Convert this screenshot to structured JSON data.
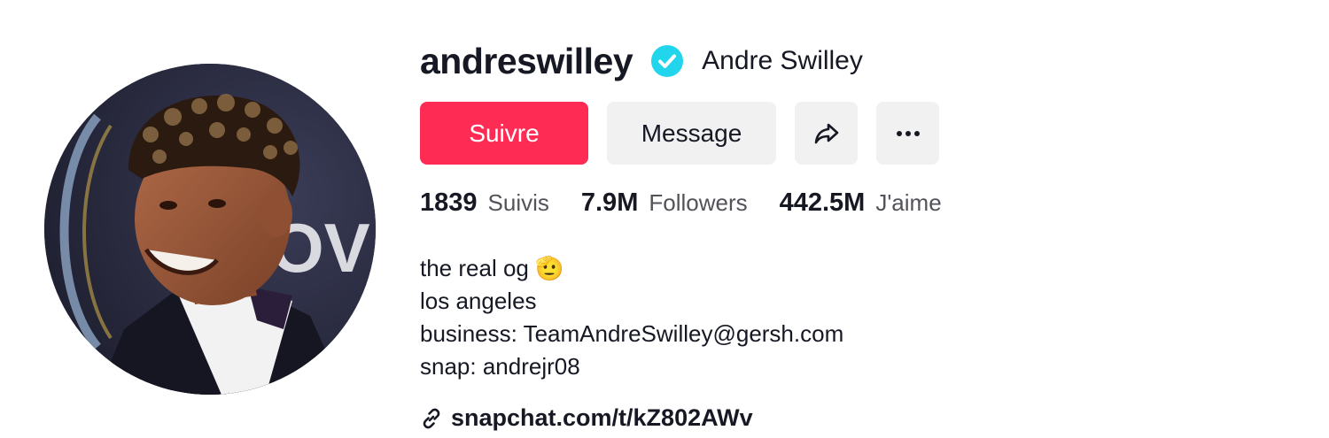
{
  "profile": {
    "username": "andreswilley",
    "display_name": "Andre Swilley",
    "verified": true
  },
  "actions": {
    "follow_label": "Suivre",
    "message_label": "Message"
  },
  "stats": [
    {
      "value": "1839",
      "label": "Suivis"
    },
    {
      "value": "7.9M",
      "label": "Followers"
    },
    {
      "value": "442.5M",
      "label": "J'aime"
    }
  ],
  "bio": {
    "line1": "the real og 🫡",
    "line2": "los angeles",
    "line3": "business: TeamAndreSwilley@gersh.com",
    "line4": "snap: andrejr08"
  },
  "link": {
    "text": "snapchat.com/t/kZ802AWv"
  },
  "colors": {
    "accent": "#fe2c55",
    "verified": "#20d5ec",
    "button_gray": "#f1f1f2",
    "text": "#161823",
    "muted": "#52535a"
  },
  "icons": {
    "verified": "verified-badge-icon",
    "share": "share-arrow-icon",
    "more": "more-dots-icon",
    "link": "link-icon"
  }
}
